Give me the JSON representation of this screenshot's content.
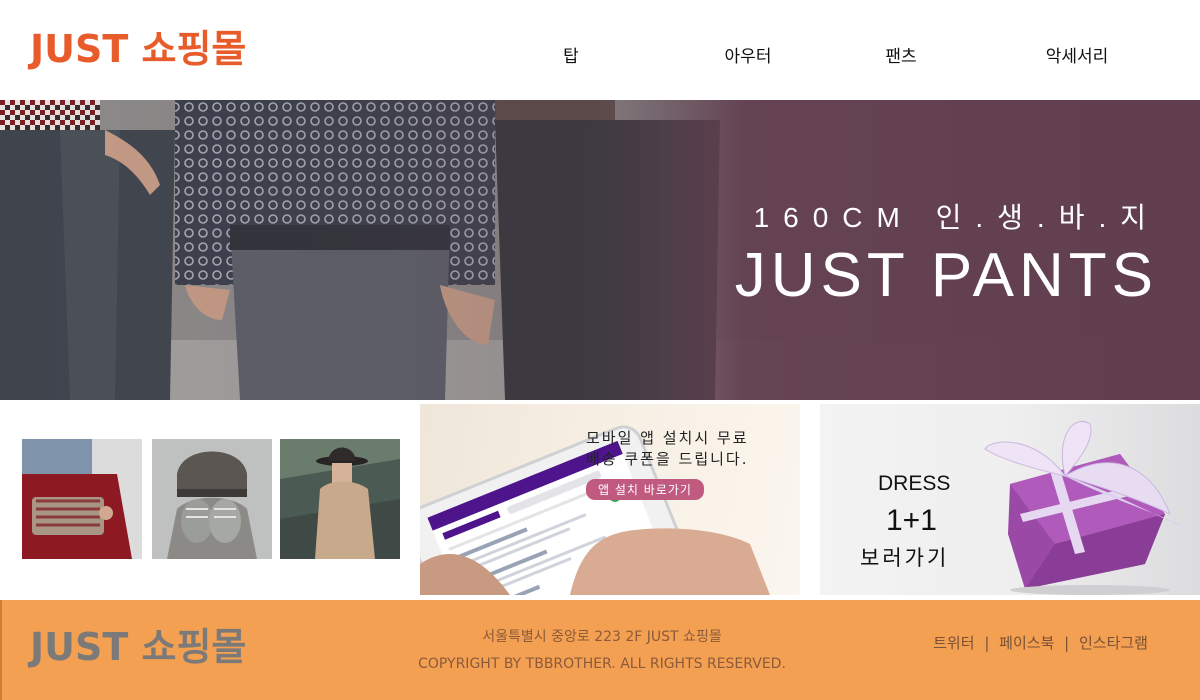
{
  "header": {
    "logo": "JUST 쇼핑몰",
    "nav": [
      "탑",
      "아우터",
      "팬츠",
      "악세서리"
    ]
  },
  "hero": {
    "subtitle": "160CM 인.생.바.지",
    "title": "JUST PANTS"
  },
  "promo_app": {
    "line1": "모바일 앱 설치시 무료",
    "line2": "배송 쿠폰을 드립니다.",
    "button": "앱 설치 바로가기"
  },
  "promo_dress": {
    "line1": "DRESS",
    "line2": "1+1",
    "line3": "보러가기"
  },
  "footer": {
    "logo": "JUST 쇼핑몰",
    "address": "서울특별시 중앙로 223 2F JUST 쇼핑몰",
    "copyright": "COPYRIGHT BY TBBROTHER. ALL RIGHTS RESERVED.",
    "links": [
      "트위터",
      "페이스북",
      "인스타그램"
    ],
    "separator": "|"
  },
  "colors": {
    "brand": "#e85c2c",
    "hero_overlay": "#623f4f",
    "footer_bg": "#f4a052",
    "app_button": "#c05a7e"
  }
}
